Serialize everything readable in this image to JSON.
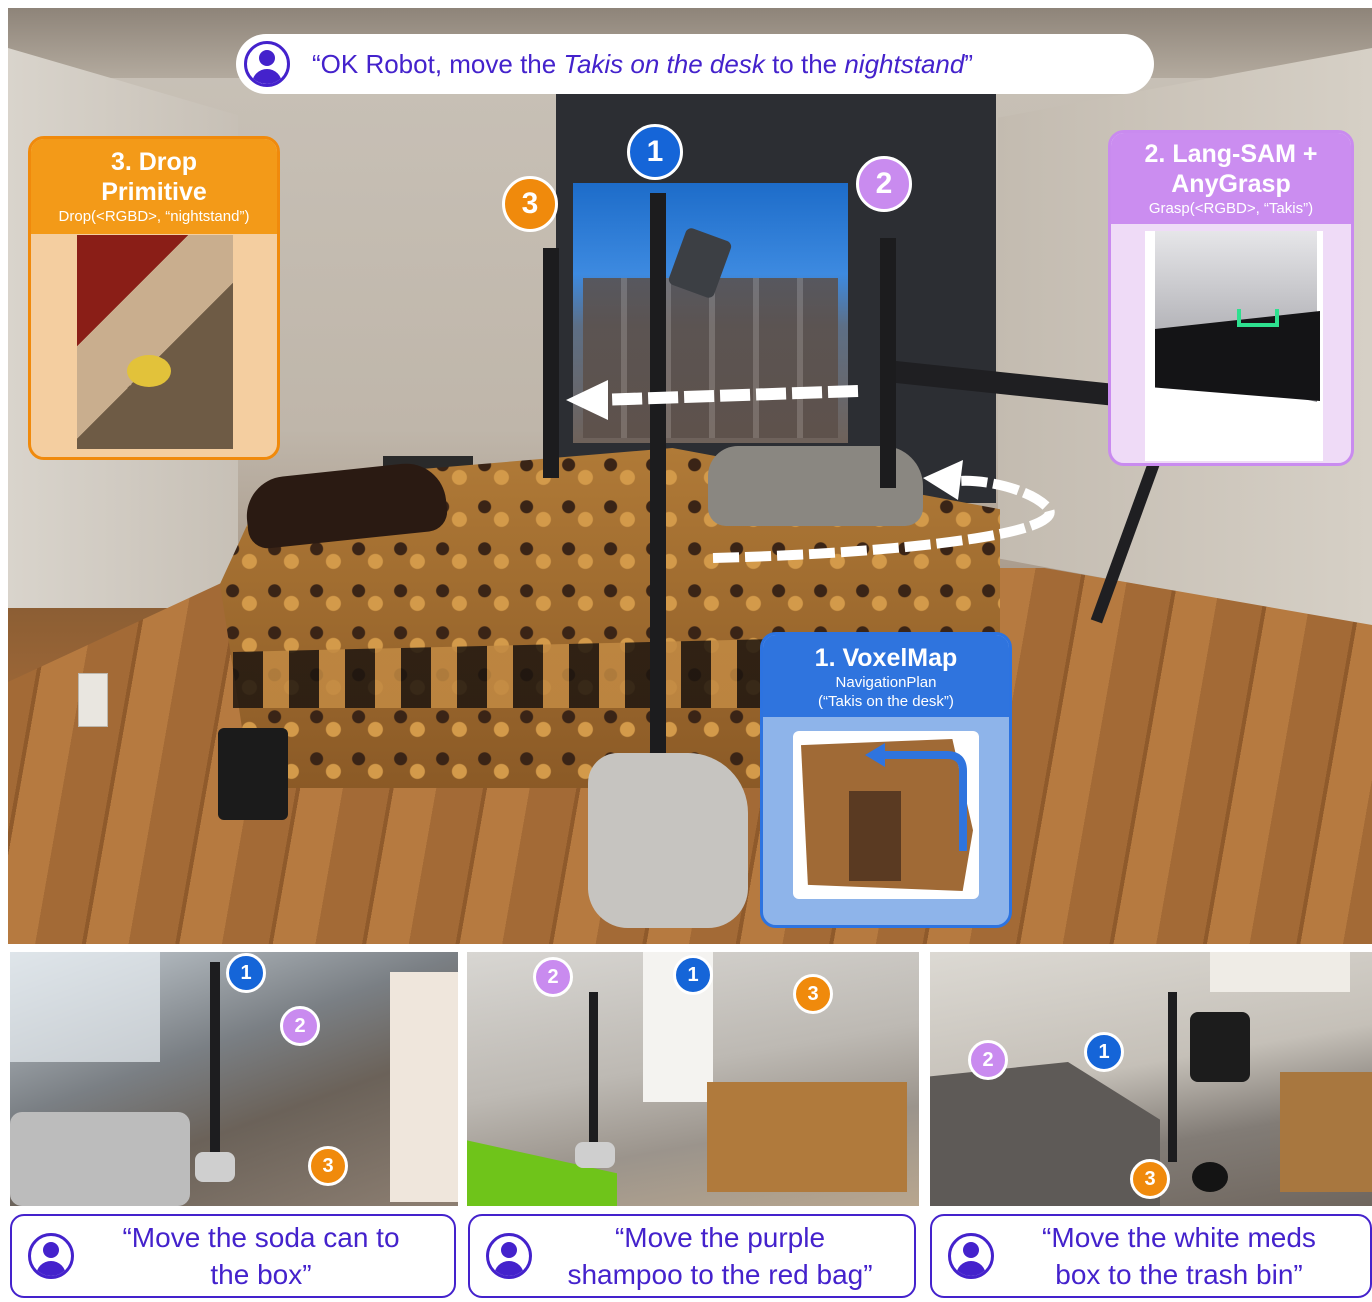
{
  "command": {
    "prefix": "“OK Robot, move the ",
    "object": "Takis on the desk",
    "middle": " to the ",
    "target": "nightstand",
    "suffix": "”"
  },
  "stages": {
    "navigation": {
      "number": "1",
      "title": "1. VoxelMap",
      "call_line1": "NavigationPlan",
      "call_line2": "(“Takis on the desk”)"
    },
    "grasp": {
      "number": "2",
      "title_line1": "2. Lang-SAM +",
      "title_line2": "AnyGrasp",
      "call": "Grasp(<RGBD>, “Takis”)"
    },
    "drop": {
      "number": "3",
      "title_line1": "3. Drop",
      "title_line2": "Primitive",
      "call": "Drop(<RGBD>, “nightstand”)"
    }
  },
  "examples": [
    {
      "markers": [
        "1",
        "2",
        "3"
      ],
      "line1": "“Move the soda can to",
      "line2": "the box”"
    },
    {
      "markers": [
        "2",
        "1",
        "3"
      ],
      "line1": "“Move the purple",
      "line2": "shampoo to the red bag”"
    },
    {
      "markers": [
        "2",
        "1",
        "3"
      ],
      "line1": "“Move the white meds",
      "line2": "box to the trash bin”"
    }
  ],
  "colors": {
    "navigation": "#1565d8",
    "grasp": "#c98bef",
    "drop": "#f08a0c",
    "text": "#4422cc"
  },
  "icons": [
    "user-icon"
  ]
}
